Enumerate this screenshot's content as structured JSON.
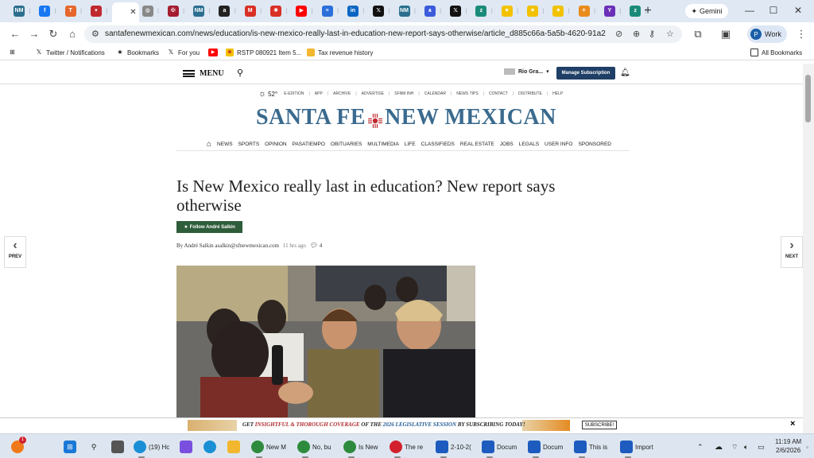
{
  "browser": {
    "tabs": [
      {
        "icon": "site-icon",
        "color": "#2a6f8f",
        "label": "NM"
      },
      {
        "icon": "facebook-icon",
        "color": "#1877f2",
        "label": "f"
      },
      {
        "icon": "orange-site-icon",
        "color": "#e6662b",
        "label": "T"
      },
      {
        "icon": "red-site-icon",
        "color": "#c0282d",
        "label": "▾"
      },
      {
        "icon": "active-tab-icon",
        "color": "#ffffff",
        "label": ""
      },
      {
        "icon": "globe-icon",
        "color": "#888888",
        "label": "◍"
      },
      {
        "icon": "harvard-icon",
        "color": "#a51c30",
        "label": "✠"
      },
      {
        "icon": "site-icon",
        "color": "#2a6f8f",
        "label": "NM"
      },
      {
        "icon": "amazon-icon",
        "color": "#222222",
        "label": "a"
      },
      {
        "icon": "gmail-icon",
        "color": "#d93025",
        "label": "M"
      },
      {
        "icon": "asterisk-icon",
        "color": "#d93025",
        "label": "✺"
      },
      {
        "icon": "youtube-icon",
        "color": "#ff0000",
        "label": "▶"
      },
      {
        "icon": "docs-icon",
        "color": "#2a6fdb",
        "label": "≡"
      },
      {
        "icon": "linkedin-icon",
        "color": "#0a66c2",
        "label": "in"
      },
      {
        "icon": "x-icon",
        "color": "#111111",
        "label": "𝕏"
      },
      {
        "icon": "site-icon",
        "color": "#2a6f8f",
        "label": "NM"
      },
      {
        "icon": "vpn-icon",
        "color": "#3b5bdb",
        "label": "∧"
      },
      {
        "icon": "x-icon",
        "color": "#111111",
        "label": "𝕏"
      },
      {
        "icon": "teal-site-icon",
        "color": "#1a8a7a",
        "label": "z"
      },
      {
        "icon": "zia-icon",
        "color": "#f2c200",
        "label": "✷"
      },
      {
        "icon": "zia-icon",
        "color": "#f2c200",
        "label": "✷"
      },
      {
        "icon": "zia-icon",
        "color": "#f2c200",
        "label": "✷"
      },
      {
        "icon": "star-site-icon",
        "color": "#e98b1a",
        "label": "✶"
      },
      {
        "icon": "purple-site-icon",
        "color": "#6b2fb8",
        "label": "Y"
      },
      {
        "icon": "teal-site-icon",
        "color": "#1a8a7a",
        "label": "z"
      }
    ],
    "gemini_label": "Gemini",
    "url": "santafenewmexican.com/news/education/is-new-mexico-really-last-in-education-new-report-says-otherwise/article_d885c66a-5a5b-4620-91a2-ff3ee88...",
    "profile_initial": "P",
    "profile_label": "Work",
    "bookmarks": [
      {
        "label": "Twitter / Notifications",
        "icon": "x-icon"
      },
      {
        "label": "Bookmarks",
        "icon": "star-icon"
      },
      {
        "label": "For you",
        "icon": "x-icon"
      },
      {
        "label": "",
        "icon": "youtube-icon"
      },
      {
        "label": "RSTP 080921 Item 5...",
        "icon": "zia-icon"
      },
      {
        "label": "Tax revenue history",
        "icon": "bookmark-icon"
      }
    ],
    "all_bookmarks": "All Bookmarks"
  },
  "site": {
    "menu_label": "MENU",
    "account_name": "Rio Gra...",
    "manage_label": "Manage Subscription",
    "weather": "52°",
    "top_links": [
      "E-EDITION",
      "APP",
      "ARCHIVE",
      "ADVERTISE",
      "SFNM INH",
      "CALENDAR",
      "NEWS TIPS",
      "CONTACT",
      "DISTRIBUTE",
      "HELP"
    ],
    "logo_left": "SANTA FE",
    "logo_right": "NEW MEXICAN",
    "sections": [
      "NEWS",
      "SPORTS",
      "OPINION",
      "PASATIEMPO",
      "OBITUARIES",
      "MULTIMEDIA",
      "LIFE",
      "CLASSIFIEDS",
      "REAL ESTATE",
      "JOBS",
      "LEGALS",
      "USER INFO",
      "SPONSORED"
    ],
    "prev": "PREV",
    "next": "NEXT"
  },
  "article": {
    "headline": "Is New Mexico really last in education? New report says otherwise",
    "follow": "Follow André Salkin",
    "byline": "By André Salkin asalkin@sfnewmexican.com",
    "time": "11 hrs ago",
    "comments": "4"
  },
  "banner": {
    "t1": "GET ",
    "t2": "INSIGHTFUL & THOROUGH COVERAGE",
    "t3": " OF THE ",
    "t4": "2026 LEGISLATIVE SESSION",
    "t5": " BY SUBSCRIBING TODAY!",
    "subscribe": "SUBSCRIBE!",
    "close": "×"
  },
  "taskbar": {
    "items": [
      {
        "label": "(19) Hc",
        "icon": "edge-icon",
        "color": "#1a8fd6"
      },
      {
        "label": "",
        "icon": "copilot-icon",
        "color": "#7a4fe0"
      },
      {
        "label": "",
        "icon": "help-icon",
        "color": "#1a8fd6"
      },
      {
        "label": "",
        "icon": "folder-icon",
        "color": "#f2b72e"
      },
      {
        "label": "New M",
        "icon": "chrome-icon",
        "color": "#2e8b3d"
      },
      {
        "label": "No, bu",
        "icon": "chrome-icon",
        "color": "#2e8b3d"
      },
      {
        "label": "Is New",
        "icon": "chrome-icon",
        "color": "#2e8b3d"
      },
      {
        "label": "The re",
        "icon": "opera-icon",
        "color": "#d3202e"
      },
      {
        "label": "2-10-2(",
        "icon": "word-icon",
        "color": "#1d5bbf"
      },
      {
        "label": "Docum",
        "icon": "word-icon",
        "color": "#1d5bbf"
      },
      {
        "label": "Docum",
        "icon": "word-icon",
        "color": "#1d5bbf"
      },
      {
        "label": "This is",
        "icon": "word-icon",
        "color": "#1d5bbf"
      },
      {
        "label": "Import",
        "icon": "word-icon",
        "color": "#1d5bbf"
      }
    ],
    "notify_badge": "1",
    "time": "11:19 AM",
    "date": "2/6/2026"
  }
}
